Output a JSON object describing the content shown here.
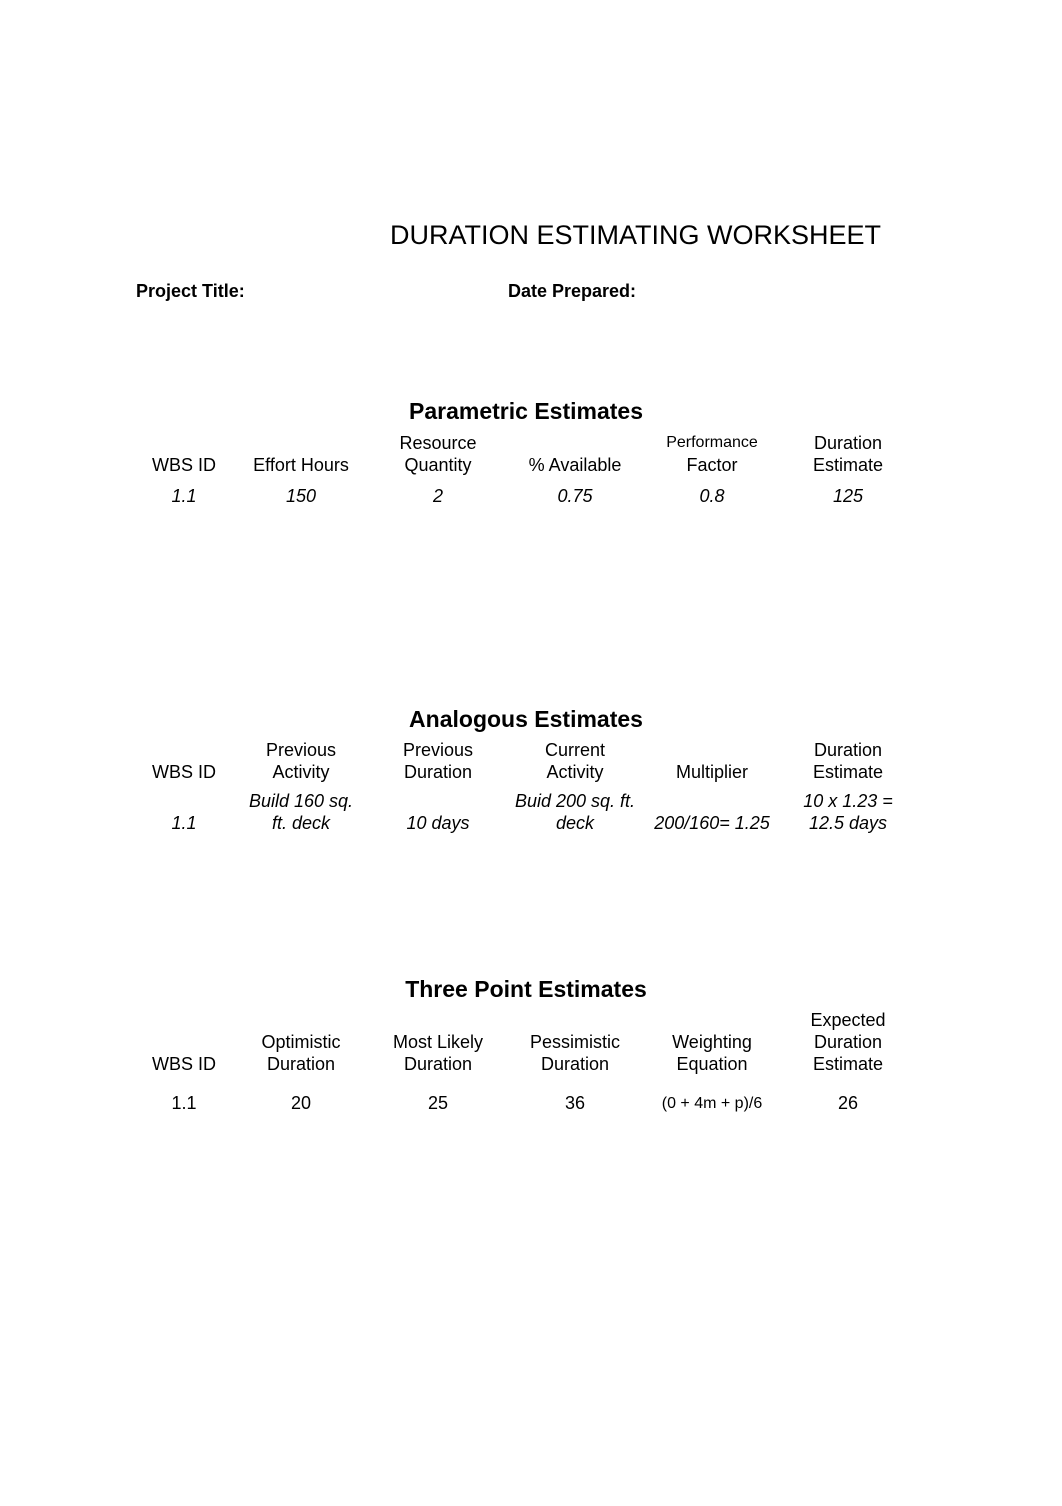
{
  "document": {
    "title": "DURATION ESTIMATING WORKSHEET",
    "project_title_label": "Project Title:",
    "date_prepared_label": "Date Prepared:"
  },
  "parametric": {
    "title": "Parametric Estimates",
    "headers": [
      [
        "",
        "WBS ID"
      ],
      [
        "",
        "Effort Hours"
      ],
      [
        "Resource",
        "Quantity"
      ],
      [
        "",
        "% Available"
      ],
      [
        "Performance",
        "Factor"
      ],
      [
        "Duration",
        "Estimate"
      ]
    ],
    "row": [
      "1.1",
      "150",
      "2",
      "0.75",
      "0.8",
      "125"
    ]
  },
  "analogous": {
    "title": "Analogous Estimates",
    "headers": [
      [
        "",
        "WBS ID"
      ],
      [
        "Previous",
        "Activity"
      ],
      [
        "Previous",
        "Duration"
      ],
      [
        "Current",
        "Activity"
      ],
      [
        "",
        "Multiplier"
      ],
      [
        "Duration",
        "Estimate"
      ]
    ],
    "row": [
      [
        "",
        "1.1"
      ],
      [
        "Build 160 sq.",
        "ft. deck"
      ],
      [
        "",
        "10 days"
      ],
      [
        "Buid 200 sq. ft.",
        "deck"
      ],
      [
        "",
        "200/160= 1.25"
      ],
      [
        "10 x 1.23 =",
        "12.5 days"
      ]
    ]
  },
  "three_point": {
    "title": "Three Point Estimates",
    "headers": [
      [
        "",
        "",
        "WBS ID"
      ],
      [
        "",
        "Optimistic",
        "Duration"
      ],
      [
        "",
        "Most Likely",
        "Duration"
      ],
      [
        "",
        "Pessimistic",
        "Duration"
      ],
      [
        "",
        "Weighting",
        "Equation"
      ],
      [
        "Expected",
        "Duration",
        "Estimate"
      ]
    ],
    "row": [
      "1.1",
      "20",
      "25",
      "36",
      "(0 + 4m + p)/6",
      "26"
    ]
  }
}
